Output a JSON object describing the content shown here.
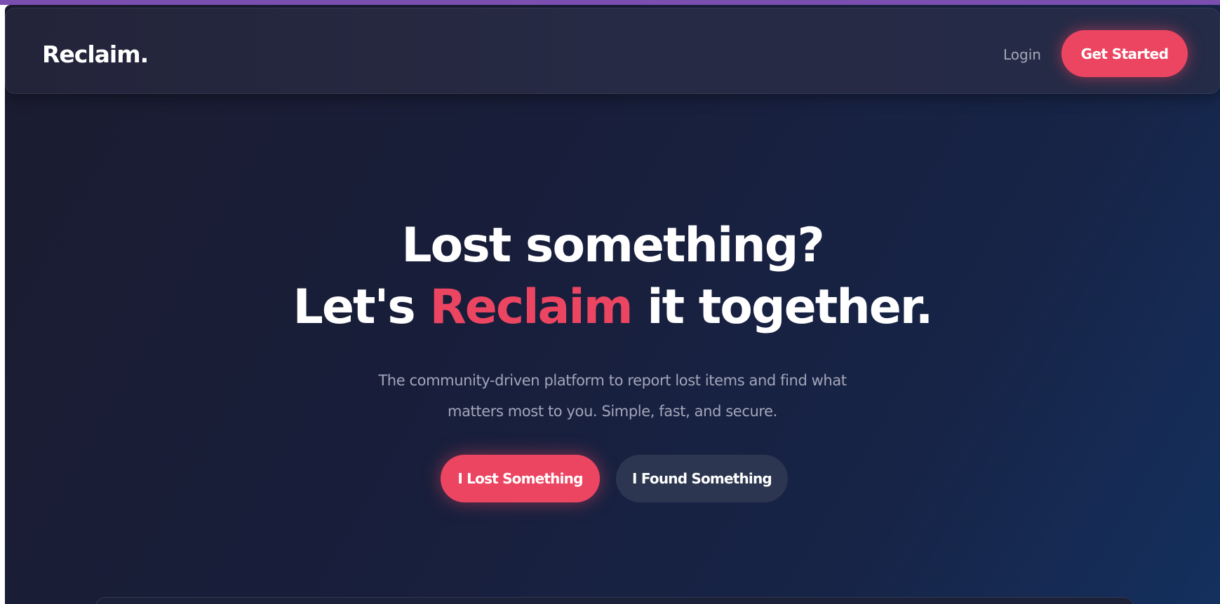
{
  "brand": {
    "logo": "Reclaim."
  },
  "nav": {
    "login_label": "Login",
    "get_started_label": "Get Started"
  },
  "hero": {
    "headline_line1": "Lost something?",
    "headline_line2_pre": "Let's ",
    "headline_line2_accent": "Reclaim",
    "headline_line2_post": " it together.",
    "subtitle_line1": "The community-driven platform to report lost items and find what",
    "subtitle_line2": "matters most to you. Simple, fast, and secure.",
    "primary_cta": "I Lost Something",
    "secondary_cta": "I Found Something"
  },
  "colors": {
    "accent": "#ec4561",
    "background": "#181e3a",
    "secondary_button": "#2c3650",
    "muted_text": "#a3a6b9"
  }
}
